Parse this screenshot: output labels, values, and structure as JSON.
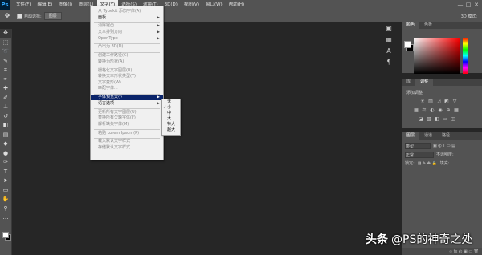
{
  "app": {
    "logo": "Ps"
  },
  "menubar": {
    "items": [
      "文件(F)",
      "编辑(E)",
      "图像(I)",
      "图层(L)",
      "文字(Y)",
      "选择(S)",
      "滤镜(T)",
      "3D(D)",
      "视图(V)",
      "窗口(W)",
      "帮助(H)"
    ],
    "active_index": 4
  },
  "window_controls": [
    "—",
    "□",
    "✕"
  ],
  "options_bar": {
    "auto_select_label": "自动选择:",
    "auto_select_value": "图层",
    "right_label": "3D 模式:"
  },
  "type_menu": {
    "items": [
      {
        "label": "从 Typekit 添加字体(A)",
        "enabled": false,
        "submenu": false
      },
      {
        "label": "面板",
        "enabled": true,
        "submenu": true
      },
      {
        "label": "消除锯齿",
        "enabled": false,
        "submenu": true
      },
      {
        "label": "文本排列方向",
        "enabled": false,
        "submenu": true
      },
      {
        "label": "OpenType",
        "enabled": false,
        "submenu": true
      },
      {
        "label": "凸出为 3D(D)",
        "enabled": false,
        "submenu": false
      },
      {
        "label": "创建工作路径(C)",
        "enabled": false,
        "submenu": false
      },
      {
        "label": "转换为形状(A)",
        "enabled": false,
        "submenu": false
      },
      {
        "label": "栅格化文字图层(R)",
        "enabled": false,
        "submenu": false
      },
      {
        "label": "转换文本形状类型(T)",
        "enabled": false,
        "submenu": false
      },
      {
        "label": "文字变形(W)...",
        "enabled": false,
        "submenu": false
      },
      {
        "label": "匹配字体...",
        "enabled": false,
        "submenu": false
      },
      {
        "label": "字体预览大小",
        "enabled": true,
        "submenu": true,
        "highlight": true
      },
      {
        "label": "语言选项",
        "enabled": true,
        "submenu": true
      },
      {
        "label": "更新所有文字图层(U)",
        "enabled": false,
        "submenu": false
      },
      {
        "label": "替换所有欠缺字体(F)",
        "enabled": false,
        "submenu": false
      },
      {
        "label": "解析缺失字体(M)",
        "enabled": false,
        "submenu": false
      },
      {
        "label": "粘贴 Lorem Ipsum(P)",
        "enabled": false,
        "submenu": false
      },
      {
        "label": "载入默认文字样式",
        "enabled": false,
        "submenu": false
      },
      {
        "label": "存储默认文字样式",
        "enabled": false,
        "submenu": false
      }
    ]
  },
  "size_submenu": {
    "items": [
      "无",
      "小",
      "中",
      "大",
      "特大",
      "超大"
    ],
    "checked_index": 1
  },
  "panels": {
    "color_tabs": [
      "颜色",
      "色板"
    ],
    "adjust_tabs": [
      "库",
      "调整"
    ],
    "adjust_title": "添加调整",
    "layer_tabs": [
      "图层",
      "通道",
      "路径"
    ],
    "layer_kind": "类型",
    "layer_mode": "正常",
    "opacity_label": "不透明度:",
    "lock_label": "锁定:",
    "fill_label": "填充:"
  },
  "watermark": {
    "logo": "头条",
    "text": "@PS的神奇之处"
  }
}
